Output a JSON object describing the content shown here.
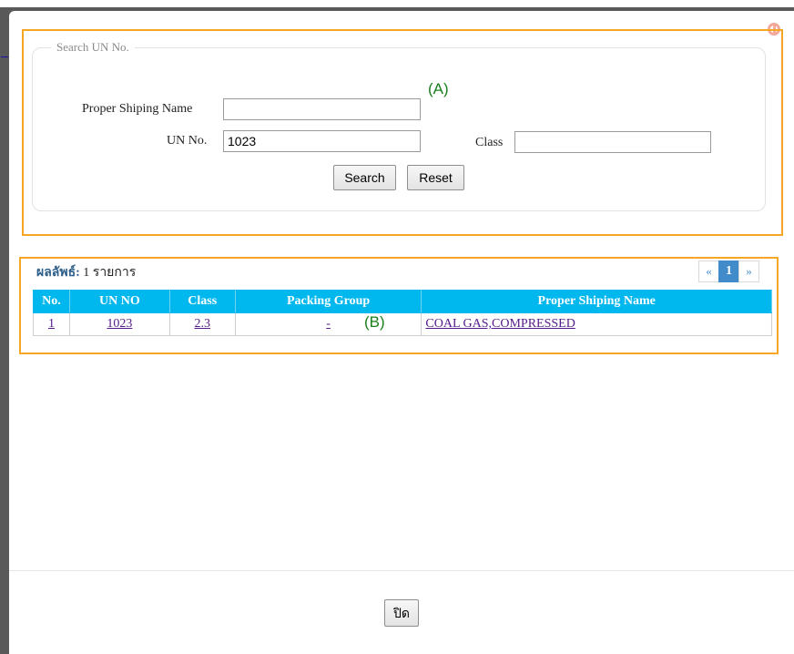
{
  "background_page": {
    "top_text": ""
  },
  "search_panel": {
    "legend": "Search UN No.",
    "proper_shipping_name_label": "Proper Shiping Name",
    "proper_shipping_name_value": "",
    "un_no_label": "UN No.",
    "un_no_value": "1023",
    "class_label": "Class",
    "class_value": "",
    "search_button": "Search",
    "reset_button": "Reset"
  },
  "annotations": {
    "a": "(A)",
    "b": "(B)"
  },
  "results": {
    "label": "ผลลัพธ์:",
    "count_text": "1 รายการ",
    "pager": {
      "prev": "«",
      "current": "1",
      "next": "»"
    },
    "columns": [
      "No.",
      "UN NO",
      "Class",
      "Packing Group",
      "Proper Shiping Name"
    ],
    "rows": [
      {
        "no": "1",
        "un_no": "1023",
        "class": "2.3",
        "packing_group": "-",
        "name": "COAL GAS,COMPRESSED"
      }
    ]
  },
  "footer": {
    "close_button": "ปิด"
  },
  "colors": {
    "header_bg": "#00b7ee",
    "annotation_border": "#f5a623",
    "annotation_text": "#1a7f1a",
    "link": "#551a8b"
  }
}
